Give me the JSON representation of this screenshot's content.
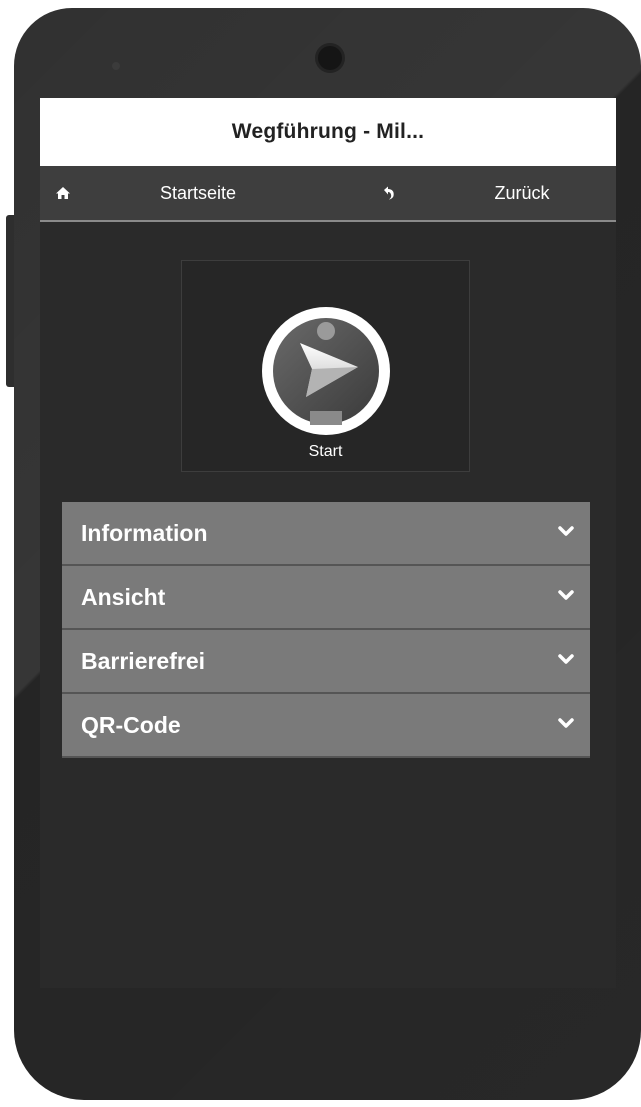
{
  "header": {
    "title": "Wegführung - Mil..."
  },
  "navbar": {
    "home_label": "Startseite",
    "home_icon": "home-icon",
    "back_label": "Zurück",
    "back_icon": "undo-arrow-icon"
  },
  "start": {
    "label": "Start",
    "icon": "navigation-pointer-icon"
  },
  "accordion": {
    "items": [
      {
        "label": "Information",
        "icon": "chevron-down-icon"
      },
      {
        "label": "Ansicht",
        "icon": "chevron-down-icon"
      },
      {
        "label": "Barrierefrei",
        "icon": "chevron-down-icon"
      },
      {
        "label": "QR-Code",
        "icon": "chevron-down-icon"
      }
    ]
  },
  "colors": {
    "header_bg": "#ffffff",
    "navbar_bg": "#3e3e3e",
    "screen_bg": "#2a2a2a",
    "accordion_bg": "#7a7a7a",
    "phone_body": "#2a2a2a"
  }
}
